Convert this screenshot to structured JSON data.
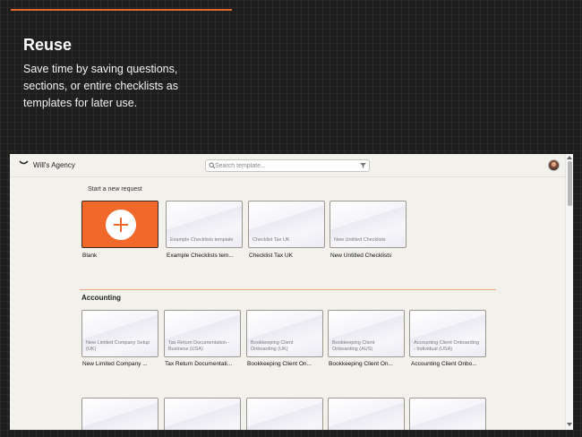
{
  "hero": {
    "title": "Reuse",
    "text": "Save time by saving questions, sections, or entire checklists as templates for later use."
  },
  "app": {
    "agency_name": "Will's Agency",
    "search_placeholder": "Search template...",
    "start_label": "Start a new request",
    "section_title": "Accounting",
    "accent_color": "#f0682a",
    "new_request_cards": [
      {
        "inner": "",
        "caption": "Blank"
      },
      {
        "inner": "Example Checklists template",
        "caption": "Example Checklists tem..."
      },
      {
        "inner": "Checklist Tax UK",
        "caption": "Checklist Tax UK"
      },
      {
        "inner": "New Untitled Checklists",
        "caption": "New Untitled Checklists"
      }
    ],
    "accounting_cards": [
      {
        "inner": "New Limited Company Setup (UK)",
        "caption": "New Limited Company ..."
      },
      {
        "inner": "Tax Return Documentation - Business (USA)",
        "caption": "Tax Return Documentati..."
      },
      {
        "inner": "Bookkeeping Client Onboarding (UK)",
        "caption": "Bookkeeping Client On..."
      },
      {
        "inner": "Bookkeeping Client Onboarding (AUS)",
        "caption": "Bookkeeping Client On..."
      },
      {
        "inner": "Accounting Client Onboarding - Individual (USA)",
        "caption": "Accounting Client Onbo..."
      }
    ]
  }
}
